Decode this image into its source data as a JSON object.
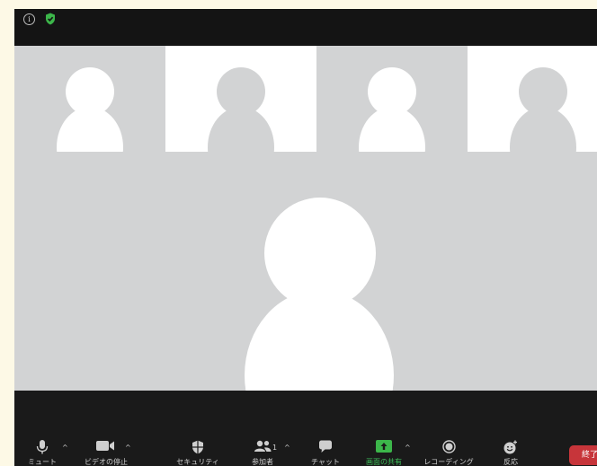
{
  "window": {
    "info_icon": "i",
    "shield_color": "#3cb64a"
  },
  "thumbnails": [
    {
      "name": "participant-1",
      "bg": "#d2d3d4",
      "avatar": "#ffffff"
    },
    {
      "name": "participant-2",
      "bg": "#ffffff",
      "avatar": "#d2d3d4"
    },
    {
      "name": "participant-3",
      "bg": "#d2d3d4",
      "avatar": "#ffffff"
    },
    {
      "name": "participant-4",
      "bg": "#ffffff",
      "avatar": "#d2d3d4"
    }
  ],
  "main_speaker": {
    "bg": "#d2d3d4",
    "avatar": "#ffffff"
  },
  "toolbar": {
    "mute_label": "ミュート",
    "video_label": "ビデオの停止",
    "security_label": "セキュリティ",
    "participants_label": "参加者",
    "participants_count": "1",
    "chat_label": "チャット",
    "share_label": "画面の共有",
    "record_label": "レコーディング",
    "reactions_label": "反応",
    "end_label": "終了",
    "share_color": "#3cb64a",
    "end_color": "#c7353a",
    "caret": "^"
  }
}
